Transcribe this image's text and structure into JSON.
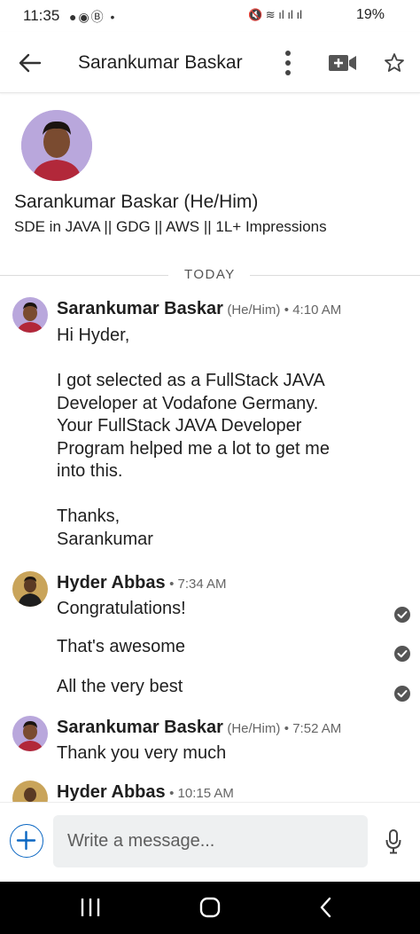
{
  "status_bar": {
    "time": "11:35",
    "battery": "19%"
  },
  "header": {
    "title": "Sarankumar Baskar"
  },
  "profile": {
    "name": "Sarankumar Baskar (He/Him)",
    "headline": "SDE in JAVA || GDG || AWS || 1L+ Impressions"
  },
  "divider": {
    "label": "TODAY"
  },
  "messages": [
    {
      "sender": "Sarankumar Baskar",
      "pronoun": "(He/Him)",
      "time": "• 4:10 AM",
      "texts": [
        "Hi Hyder,\n\nI got selected as a FullStack JAVA\nDeveloper at Vodafone Germany.\nYour FullStack JAVA Developer\nProgram helped me a lot to get me\ninto this.\n\nThanks,\nSarankumar"
      ]
    },
    {
      "sender": "Hyder Abbas",
      "time": "• 7:34 AM",
      "texts": [
        "Congratulations!",
        "That's awesome",
        "All the very best"
      ]
    },
    {
      "sender": "Sarankumar Baskar",
      "pronoun": "(He/Him)",
      "time": "• 7:52 AM",
      "texts": [
        "Thank you very much"
      ]
    },
    {
      "sender": "Hyder Abbas",
      "time": "• 10:15 AM",
      "texts": []
    }
  ],
  "composer": {
    "placeholder": "Write a message..."
  },
  "colors": {
    "accent": "#0a66c2",
    "seen": "#555555",
    "nav_bar": "#000000"
  },
  "icons": [
    "back-arrow-icon",
    "more-vertical-icon",
    "video-call-icon",
    "star-icon",
    "plus-icon",
    "microphone-icon",
    "checkmark-icon",
    "recent-apps-icon",
    "home-icon",
    "back-nav-icon"
  ]
}
